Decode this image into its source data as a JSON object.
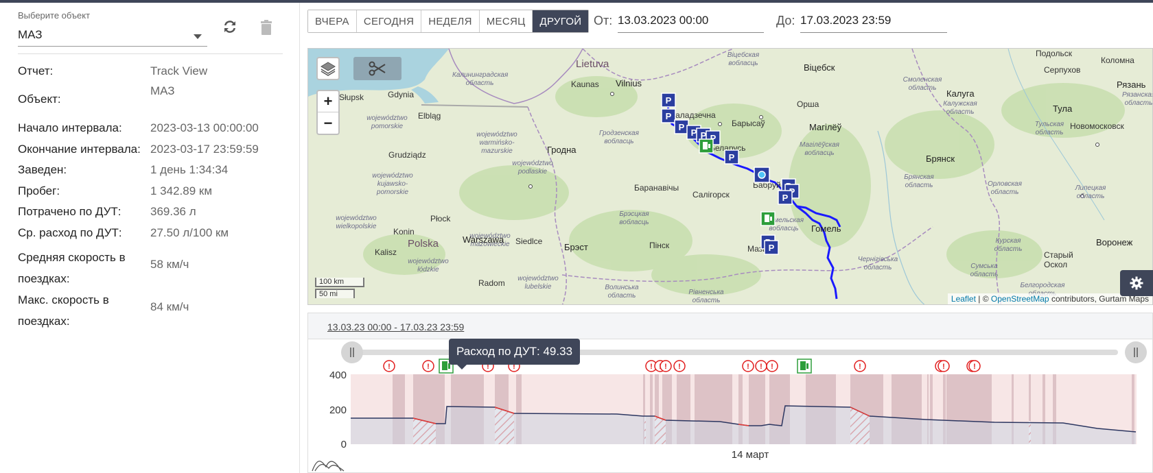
{
  "object_select": {
    "label": "Выберите объект",
    "value": "МАЗ",
    "refresh_icon": "refresh-icon",
    "delete_icon": "trash-icon"
  },
  "report_info": [
    {
      "label": "Отчет:",
      "value": "Track View"
    },
    {
      "label": "Объект:",
      "value": "МАЗ"
    },
    {
      "label": "Начало интервала:",
      "value": "2023-03-13 00:00:00"
    },
    {
      "label": "Окончание интервала:",
      "value": "2023-03-17 23:59:59"
    },
    {
      "label": "Заведен:",
      "value": "1 день 1:34:34"
    },
    {
      "label": "Пробег:",
      "value": "1 342.89 км"
    },
    {
      "label": "Потрачено по ДУТ:",
      "value": "369.36 л"
    },
    {
      "label": "Ср. расход по ДУТ:",
      "value": "27.50 л/100 км"
    },
    {
      "label": "Средняя скорость в поездках:",
      "value": "58 км/ч"
    },
    {
      "label": "Макс. скорость в поездках:",
      "value": "84 км/ч"
    }
  ],
  "periods": [
    "ВЧЕРА",
    "СЕГОДНЯ",
    "НЕДЕЛЯ",
    "МЕСЯЦ",
    "ДРУГОЙ"
  ],
  "active_period": "ДРУГОЙ",
  "date_from": {
    "label": "От:",
    "value": "13.03.2023 00:00"
  },
  "date_to": {
    "label": "До:",
    "value": "17.03.2023 23:59"
  },
  "map": {
    "zoom_in": "+",
    "zoom_out": "−",
    "scale_km": "100 km",
    "scale_mi": "50 mi",
    "attribution_leaflet": "Leaflet",
    "attribution_sep": " | © ",
    "attribution_osm": "OpenStreetMap",
    "attribution_rest": " contributors, Gurtam Maps",
    "labels": {
      "lietuva": "Lietuva",
      "vilnius": "Vilnius",
      "kaunas": "Kaunas",
      "kalinin": "Калининградская область",
      "gdynia": "Gdynia",
      "slupsk": "Słupsk",
      "elblag": "Elbląg",
      "grudziadz": "Grudziądz",
      "pomorskie": "województwo pomorskie",
      "warminsko": "województwo warmińsko-mazurskie",
      "kujawsko": "województwo kujawsko-pomorskie",
      "wielkopolskie": "województwo wielkopolskie",
      "podlaskie": "województwo podlaskie",
      "mazowieckie": "województwo mazowieckie",
      "lodzkie": "województwo łódzkie",
      "lubelskie": "województwo lubelskie",
      "plock": "Płock",
      "konin": "Konin",
      "polska": "Polska",
      "warszawa": "Warszawa",
      "siedlce": "Siedlce",
      "kalisz": "Kalisz",
      "radom": "Radom",
      "grodno": "Гродна",
      "grodno_obl": "Гродзенская вобласць",
      "baranovichi": "Баранавічы",
      "soligorsk": "Салігорск",
      "brest": "Брэст",
      "brest_obl": "Брэсцкая вобласць",
      "pinsk": "Пінск",
      "volyn": "Волинська область",
      "rivne": "Рівненська область",
      "vitebsk_obl": "Віцебская вобласць",
      "vitebsk": "Віцебск",
      "orsha": "Орша",
      "barysau": "Барысаў",
      "maladechna": "Маладзечна",
      "belarus": "Беларусь",
      "mogilev": "Магілёў",
      "mogilev_obl": "Магілёўская вобласць",
      "babruisk": "Бабруйск",
      "gomel": "Гомель",
      "gomel_obl": "Гомельская вобласць",
      "mozyr": "Мазыр",
      "smolensk_obl": "Смоленская область",
      "kaluga": "Калуга",
      "kaluga_obl": "Калужская область",
      "podolsk": "Подольск",
      "kolomna": "Коломна",
      "serpukhov": "Серпухов",
      "ryazan": "Рязань",
      "ryazan_obl": "Рязанская область",
      "tula": "Тула",
      "tula_obl": "Тульская область",
      "novomoskovsk": "Новомосковск",
      "bryansk": "Брянск",
      "bryansk_obl": "Брянская область",
      "orel_obl": "Орловская область",
      "lipetsk_obl": "Липецкая область",
      "voronezh": "Воронеж",
      "kursk_obl": "Курская область",
      "stary_oskol": "Старый Оскол",
      "belgorod_obl": "Белгородская область",
      "chernihiv": "Чернігівська область",
      "sumy": "Сумська область"
    }
  },
  "timeline": {
    "range_text": "13.03.23 00:00 - 17.03.23 23:59",
    "tooltip": "Расход по ДУТ: 49.33",
    "x_label": "14 март",
    "y_ticks": [
      "400",
      "200",
      "0"
    ],
    "mini_chart_icon": "area-chart-icon"
  },
  "colors": {
    "dark": "#3f4659",
    "track": "#1a1aff",
    "parking": "#2b3ea0",
    "fuel": "#2e9e3b",
    "alert": "#e11d1d"
  }
}
